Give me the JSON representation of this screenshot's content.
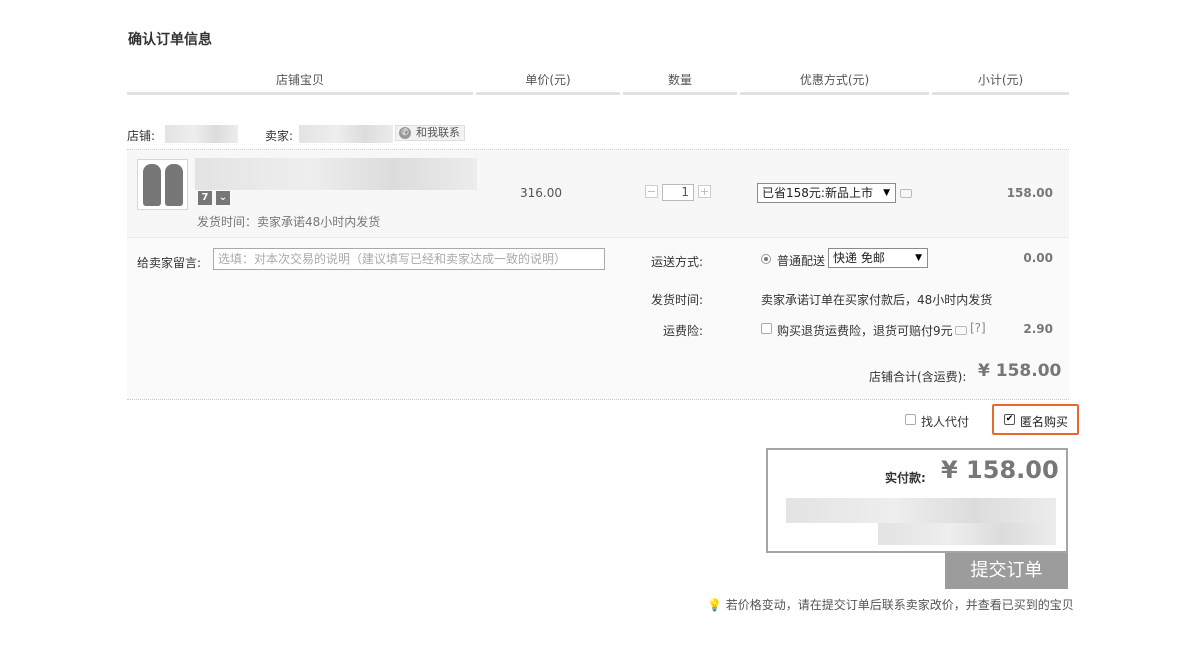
{
  "page_title": "确认订单信息",
  "table_headers": [
    "店铺宝贝",
    "单价(元)",
    "数量",
    "优惠方式(元)",
    "小计(元)"
  ],
  "shop": {
    "shop_label": "店铺:",
    "seller_label": "卖家:",
    "contact_label": "和我联系"
  },
  "item": {
    "badge_7": "7",
    "ship_note": "发货时间：卖家承诺48小时内发货",
    "unit_price": "316.00",
    "quantity": "1",
    "decrement": "−",
    "increment": "+",
    "discount_selected": "已省158元:新品上市",
    "subtotal": "158.00"
  },
  "message": {
    "label": "给卖家留言:",
    "placeholder": "选填：对本次交易的说明（建议填写已经和卖家达成一致的说明）"
  },
  "delivery": {
    "label": "运送方式:",
    "option": "普通配送",
    "selected": "快递 免邮",
    "fee": "0.00"
  },
  "ship_time": {
    "label": "发货时间:",
    "value": "卖家承诺订单在买家付款后，48小时内发货"
  },
  "insurance": {
    "label": "运费险:",
    "text": "购买退货运费险，退货可赔付9元",
    "help": "[?]",
    "fee": "2.90"
  },
  "shop_total": {
    "label": "店铺合计(含运费):",
    "value": "¥ 158.00"
  },
  "options": {
    "find_payer": "找人代付",
    "anonymous": "匿名购买",
    "anonymous_checked": true
  },
  "payment": {
    "label": "实付款:",
    "amount": "¥ 158.00",
    "submit": "提交订单"
  },
  "tip": "若价格变动，请在提交订单后联系卖家改价，并查看已买到的宝贝",
  "colors": {
    "highlight_border": "#e8692c",
    "submit_bg": "#9c9c9c"
  }
}
